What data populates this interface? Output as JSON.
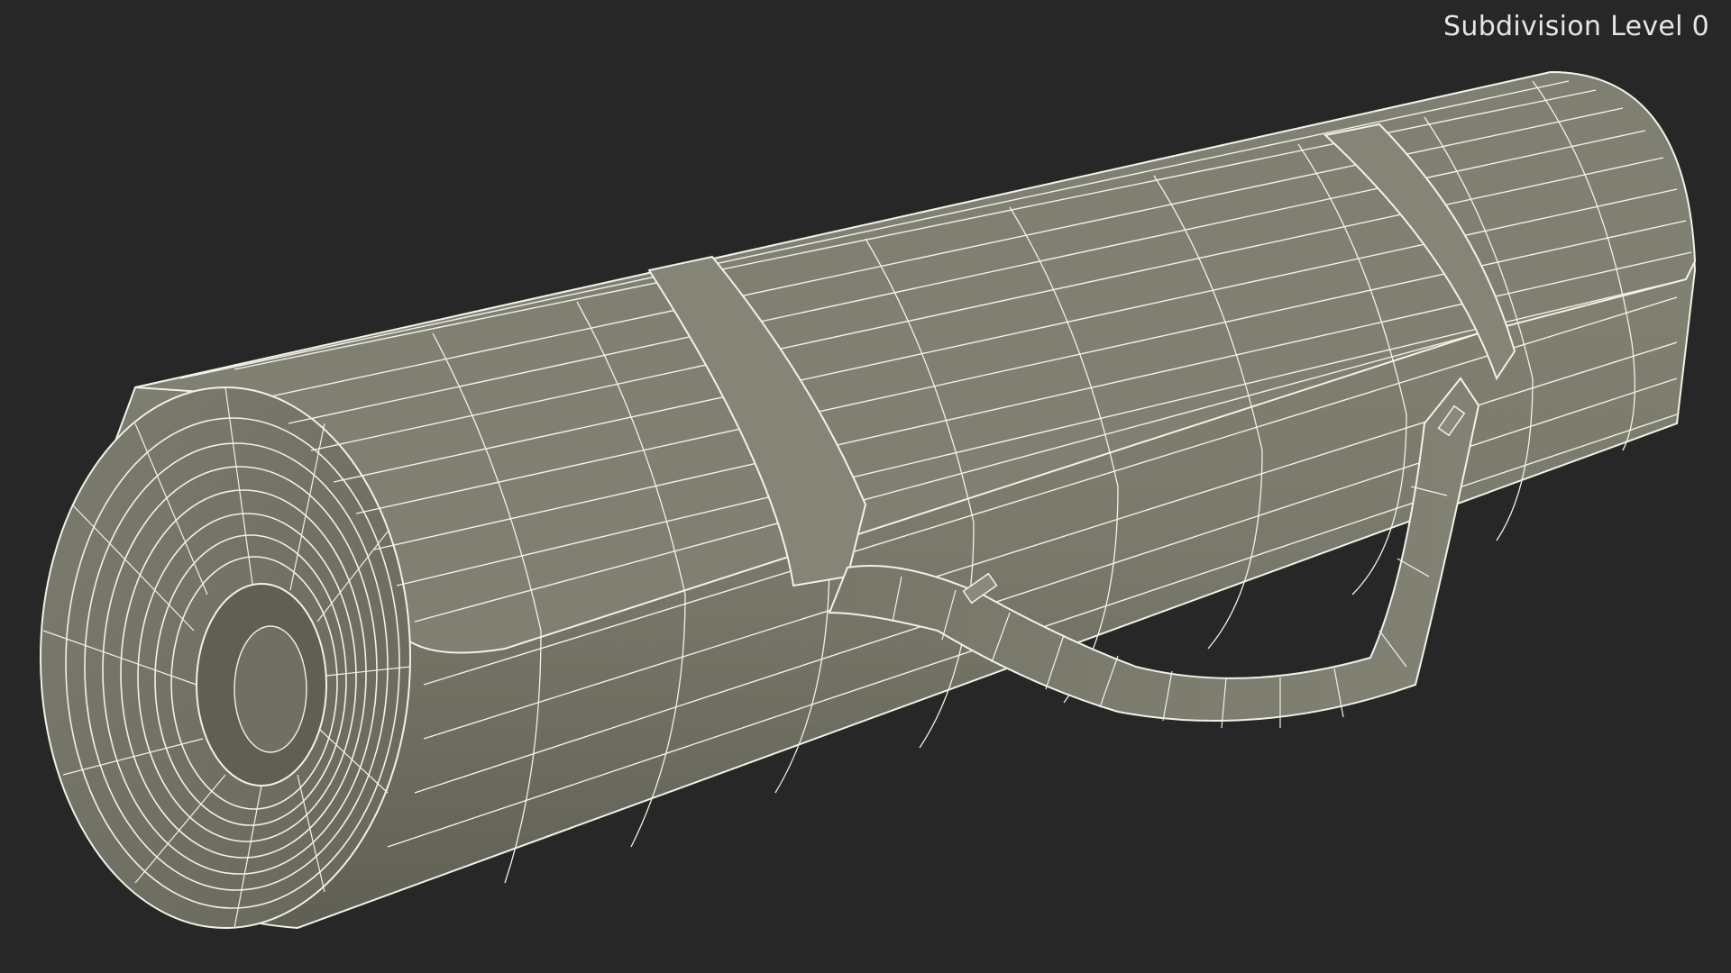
{
  "viewport": {
    "label": "Subdivision Level 0"
  },
  "colors": {
    "background": "#272727",
    "mesh_fill": "#7a7a6c",
    "mesh_shade": "#5e5e52",
    "wire": "#f1f1e6"
  },
  "model": {
    "subject": "rolled-mat-with-strap-icon"
  }
}
